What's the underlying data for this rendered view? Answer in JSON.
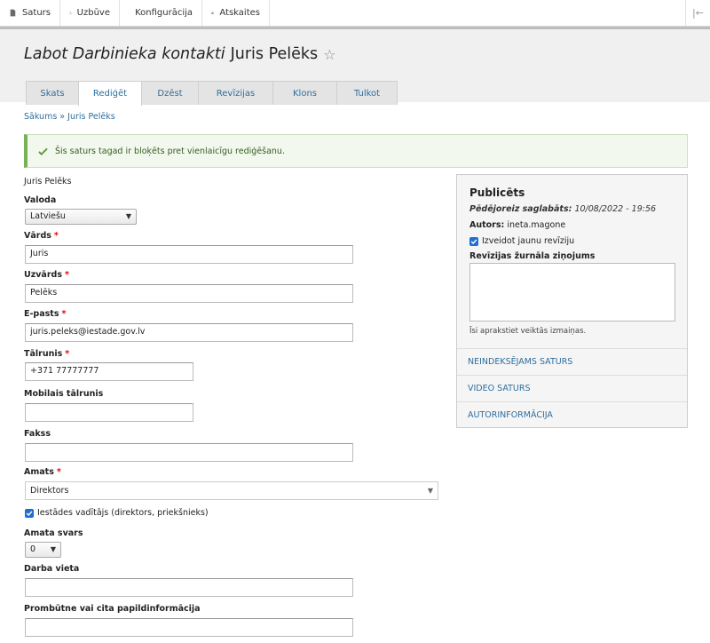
{
  "toolbar": {
    "items": [
      {
        "label": "Saturs",
        "icon": "document-icon"
      },
      {
        "label": "Uzbūve",
        "icon": "structure-icon"
      },
      {
        "label": "Konfigurācija",
        "icon": "wrench-icon"
      },
      {
        "label": "Atskaites",
        "icon": "bar-chart-icon"
      }
    ],
    "collapse_icon": "collapse-icon"
  },
  "header": {
    "title_italic": "Labot Darbinieka kontakti",
    "title_name": "Juris Pelēks",
    "tabs": [
      "Skats",
      "Rediģēt",
      "Dzēst",
      "Revīzijas",
      "Klons",
      "Tulkot"
    ],
    "active_tab": "Rediģēt"
  },
  "breadcrumb": "Sākums » Juris Pelēks",
  "message": "Šis saturs tagad ir bloķēts pret vienlaicīgu rediģēšanu.",
  "form": {
    "node_title": "Juris Pelēks",
    "language_label": "Valoda",
    "language_value": "Latviešu",
    "first_name_label": "Vārds",
    "first_name_value": "Juris",
    "last_name_label": "Uzvārds",
    "last_name_value": "Pelēks",
    "email_label": "E-pasts",
    "email_value": "juris.peleks@iestade.gov.lv",
    "phone_label": "Tālrunis",
    "phone_value": "+371 77777777",
    "mobile_label": "Mobilais tālrunis",
    "mobile_value": "",
    "fax_label": "Fakss",
    "fax_value": "",
    "position_label": "Amats",
    "position_value": "Direktors",
    "head_checkbox_label": "Iestādes vadītājs (direktors, priekšnieks)",
    "head_checked": true,
    "weight_label": "Amata svars",
    "weight_value": "0",
    "workplace_label": "Darba vieta",
    "workplace_value": "",
    "absence_label": "Prombūtne vai cita papildinformācija",
    "absence_value": "",
    "required_mark": "*"
  },
  "sidebar": {
    "status": "Publicēts",
    "saved_label": "Pēdējoreiz saglabāts:",
    "saved_value": "10/08/2022 - 19:56",
    "author_label": "Autors:",
    "author_value": "ineta.magone",
    "revision_checkbox_label": "Izveidot jaunu revīziju",
    "revision_checked": true,
    "revision_log_label": "Revīzijas žurnāla ziņojums",
    "revision_help": "Īsi aprakstiet veiktās izmaiņas.",
    "sections": [
      "NEINDEKSĒJAMS SATURS",
      "VIDEO SATURS",
      "AUTORINFORMĀCIJA"
    ]
  },
  "colors": {
    "link": "#2f6e9e",
    "success_border": "#77b259",
    "required": "#ee0000",
    "checkbox": "#1f6fd1"
  }
}
